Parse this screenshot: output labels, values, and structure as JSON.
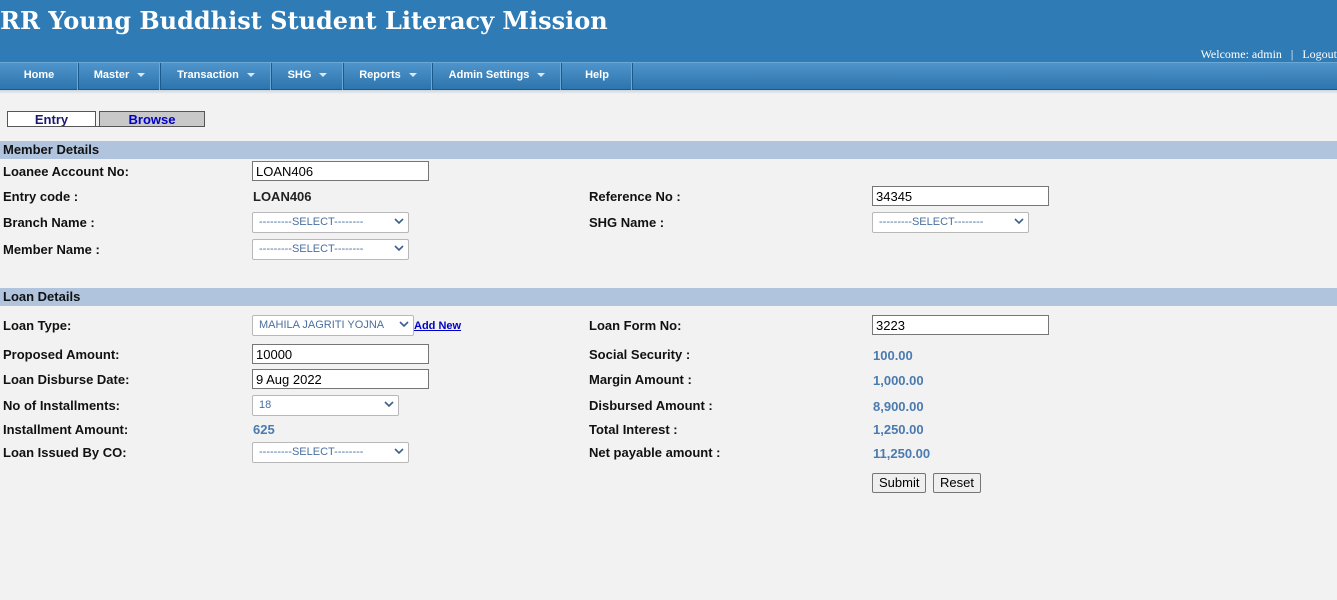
{
  "header": {
    "title": "RR Young Buddhist Student Literacy Mission",
    "welcome_prefix": "Welcome:",
    "user": "admin",
    "separator": "|",
    "logout": "Logout"
  },
  "nav": {
    "items": [
      {
        "label": "Home"
      },
      {
        "label": "Master"
      },
      {
        "label": "Transaction"
      },
      {
        "label": "SHG"
      },
      {
        "label": "Reports"
      },
      {
        "label": "Admin Settings"
      },
      {
        "label": "Help"
      }
    ]
  },
  "tabs": {
    "entry": "Entry",
    "browse": "Browse"
  },
  "member": {
    "section_title": "Member Details",
    "loanee_account_label": "Loanee Account No:",
    "loanee_account_value": "LOAN406",
    "entry_code_label": "Entry code :",
    "entry_code_value": "LOAN406",
    "reference_label": "Reference No :",
    "reference_value": "34345",
    "branch_label": "Branch Name :",
    "branch_value": "---------SELECT--------",
    "shg_label": "SHG Name :",
    "shg_value": "---------SELECT--------",
    "member_label": "Member Name :",
    "member_value": "---------SELECT--------"
  },
  "loan": {
    "section_title": "Loan Details",
    "type_label": "Loan Type:",
    "type_value": "MAHILA JAGRITI YOJNA",
    "add_new": "Add New",
    "form_no_label": "Loan Form No:",
    "form_no_value": "3223",
    "proposed_label": "Proposed Amount:",
    "proposed_value": "10000",
    "social_security_label": "Social Security :",
    "social_security_value": "100.00",
    "disburse_date_label": "Loan Disburse Date:",
    "disburse_date_value": "9 Aug 2022",
    "margin_label": "Margin Amount :",
    "margin_value": "1,000.00",
    "installments_label": "No of Installments:",
    "installments_value": "18",
    "disbursed_label": "Disbursed Amount :",
    "disbursed_value": "8,900.00",
    "installment_amount_label": "Installment Amount:",
    "installment_amount_value": "625",
    "total_interest_label": "Total Interest :",
    "total_interest_value": "1,250.00",
    "issued_by_label": "Loan Issued By CO:",
    "issued_by_value": "---------SELECT--------",
    "net_payable_label": "Net payable amount :",
    "net_payable_value": "11,250.00"
  },
  "buttons": {
    "submit": "Submit",
    "reset": "Reset"
  }
}
